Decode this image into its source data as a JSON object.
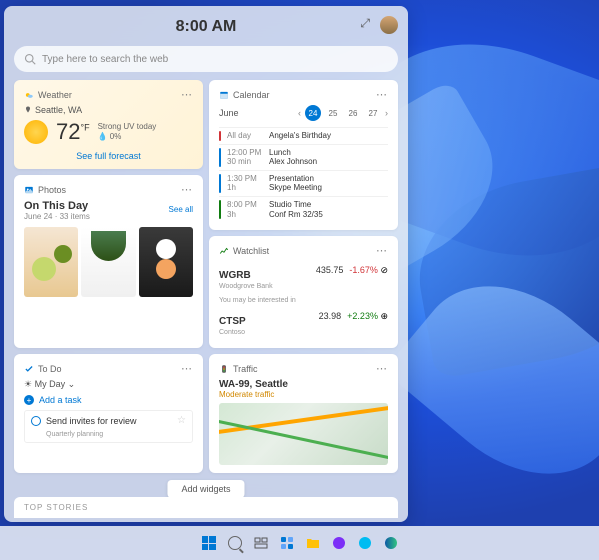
{
  "header": {
    "time": "8:00 AM"
  },
  "search": {
    "placeholder": "Type here to search the web"
  },
  "weather": {
    "title": "Weather",
    "location": "Seattle, WA",
    "temp": "72",
    "unit": "°F",
    "condition": "Strong UV today",
    "precipitation": "0%",
    "link": "See full forecast"
  },
  "calendar": {
    "title": "Calendar",
    "month": "June",
    "days": [
      "24",
      "25",
      "26",
      "27"
    ],
    "active_day": "24",
    "events": [
      {
        "time": "All day",
        "duration": "",
        "name": "Angela's Birthday",
        "color": "#d13438"
      },
      {
        "time": "12:00 PM",
        "duration": "30 min",
        "name": "Lunch\nAlex Johnson",
        "color": "#0078d4"
      },
      {
        "time": "1:30 PM",
        "duration": "1h",
        "name": "Presentation\nSkype Meeting",
        "color": "#0078d4"
      },
      {
        "time": "8:00 PM",
        "duration": "3h",
        "name": "Studio Time\nConf Rm 32/35",
        "color": "#107c10"
      }
    ]
  },
  "photos": {
    "title": "Photos",
    "heading": "On This Day",
    "sub": "June 24 · 33 items",
    "seeall": "See all"
  },
  "watchlist": {
    "title": "Watchlist",
    "items": [
      {
        "symbol": "WGRB",
        "name": "Woodgrove Bank",
        "price": "435.75",
        "change": "-1.67%",
        "dir": "neg"
      },
      {
        "symbol": "CTSP",
        "name": "Contoso",
        "price": "23.98",
        "change": "+2.23%",
        "dir": "pos"
      }
    ],
    "note": "You may be interested in"
  },
  "todo": {
    "title": "To Do",
    "list": "My Day",
    "add": "Add a task",
    "task": "Send invites for review",
    "task_sub": "Quarterly planning"
  },
  "traffic": {
    "title": "Traffic",
    "route": "WA-99, Seattle",
    "status": "Moderate traffic"
  },
  "footer": {
    "add": "Add widgets",
    "stories": "TOP STORIES"
  }
}
